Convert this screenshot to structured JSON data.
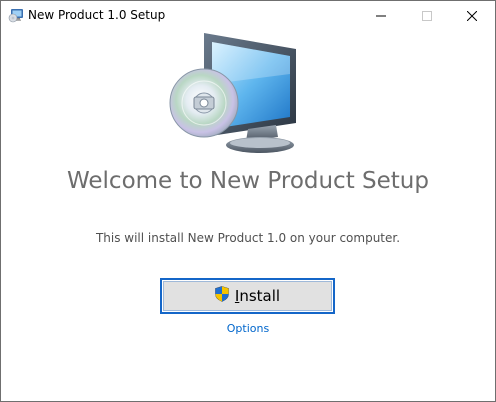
{
  "window": {
    "title": "New Product 1.0 Setup"
  },
  "titlebar_icons": [
    "installer-icon",
    "minimize-icon",
    "maximize-icon",
    "close-icon"
  ],
  "hero_icon": "computer-cd-icon",
  "main": {
    "heading": "Welcome to New Product Setup",
    "description": "This will install New Product 1.0 on your computer.",
    "install_label": "Install",
    "install_icon": "uac-shield-icon",
    "options_label": "Options"
  },
  "colors": {
    "heading": "#6d6d6d",
    "link": "#0066cc",
    "button_focus_border": "#1466c8",
    "button_face": "#e1e1e1"
  }
}
